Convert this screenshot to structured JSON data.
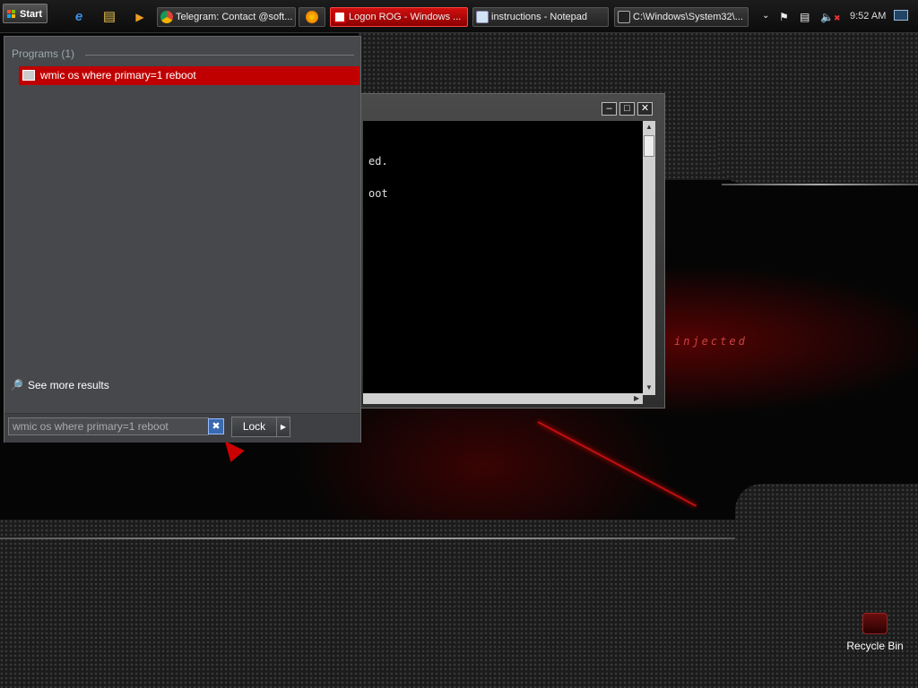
{
  "taskbar": {
    "start_label": "Start",
    "quick_launch": [
      {
        "icon": "internet-explorer-icon",
        "glyph": "e"
      },
      {
        "icon": "folder-icon",
        "glyph": "▤"
      },
      {
        "icon": "media-player-icon",
        "glyph": "▶"
      }
    ],
    "tasks": [
      {
        "label": "Telegram: Contact @soft...",
        "icon": "chrome-icon",
        "active": false
      },
      {
        "label": "",
        "icon": "firefox-icon",
        "active": false
      },
      {
        "label": "Logon ROG - Windows ...",
        "icon": "window-icon",
        "active": true
      },
      {
        "label": "instructions - Notepad",
        "icon": "notepad-icon",
        "active": false
      },
      {
        "label": "C:\\Windows\\System32\\...",
        "icon": "cmd-icon",
        "active": false
      }
    ],
    "tray_icons": [
      "chevron-down-icon",
      "flag-icon",
      "network-icon",
      "volume-muted-icon"
    ],
    "clock": "9:52 AM"
  },
  "console": {
    "lines": [
      "ed.",
      "oot"
    ]
  },
  "start_menu": {
    "section_title": "Programs (1)",
    "results": [
      {
        "label": "wmic os where primary=1 reboot",
        "icon": "program-icon"
      }
    ],
    "see_more": "See more results",
    "search_value": "wmic os where primary=1 reboot",
    "lock_label": "Lock"
  },
  "desktop": {
    "wallpaper_text": "injected",
    "icons": [
      {
        "label": "Recycle Bin",
        "icon": "recycle-bin-icon"
      }
    ]
  },
  "colors": {
    "accent_red": "#c00000",
    "menu_bg": "#46484c",
    "taskbar_bg": "#111111"
  }
}
